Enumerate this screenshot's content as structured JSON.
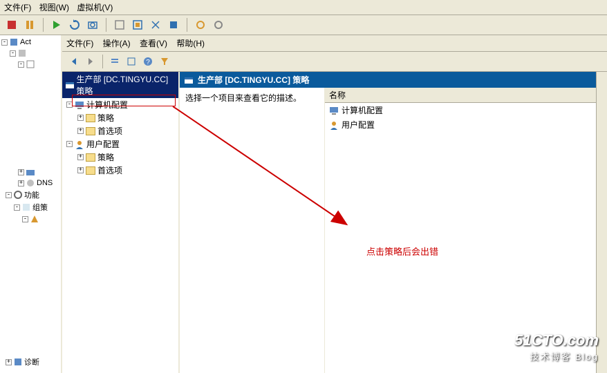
{
  "outerMenu": {
    "file": "文件(F)",
    "view": "视图(W)",
    "vm": "虚拟机(V)"
  },
  "innerMenu": {
    "file": "文件(F)",
    "action": "操作(A)",
    "view": "查看(V)",
    "help": "帮助(H)"
  },
  "leftTree": {
    "act": "Act",
    "dns": "DNS",
    "func": "功能",
    "group": "组策",
    "diag": "诊断"
  },
  "policyTree": {
    "root": "生产部 [DC.TINGYU.CC] 策略",
    "compConfig": "计算机配置",
    "policy": "策略",
    "pref": "首选项",
    "userConfig": "用户配置"
  },
  "header": {
    "title": "生产部 [DC.TINGYU.CC] 策略"
  },
  "desc": "选择一个项目来查看它的描述。",
  "listHeader": "名称",
  "listItems": {
    "comp": "计算机配置",
    "user": "用户配置"
  },
  "annotation": "点击策略后会出错",
  "watermark": {
    "line1": "51CTO.com",
    "line2": "技术博客  Blog"
  }
}
